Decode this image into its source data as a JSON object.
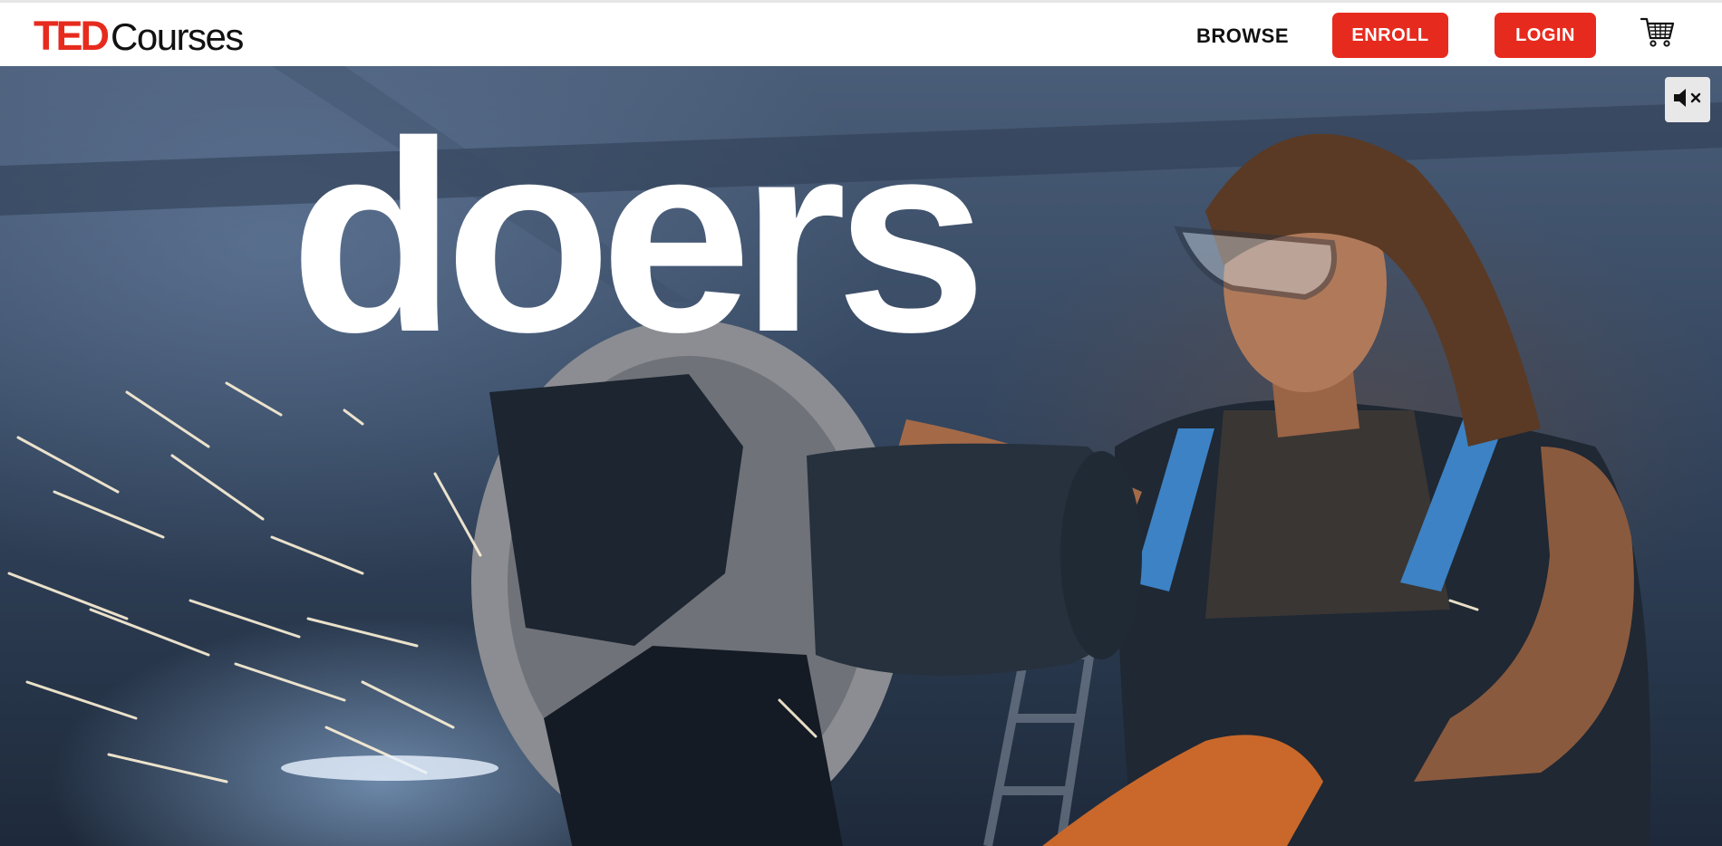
{
  "header": {
    "logo": {
      "brand": "TED",
      "product": "Courses"
    },
    "nav": {
      "browse_label": "BROWSE",
      "enroll_label": "ENROLL",
      "login_label": "LOGIN"
    },
    "cart_icon": "shopping-cart-icon"
  },
  "hero": {
    "headline": "doers",
    "mute_icon": "volume-muted-icon"
  },
  "colors": {
    "brand_red": "#e62b1e",
    "header_bg": "#ffffff",
    "headline": "#ffffff"
  }
}
